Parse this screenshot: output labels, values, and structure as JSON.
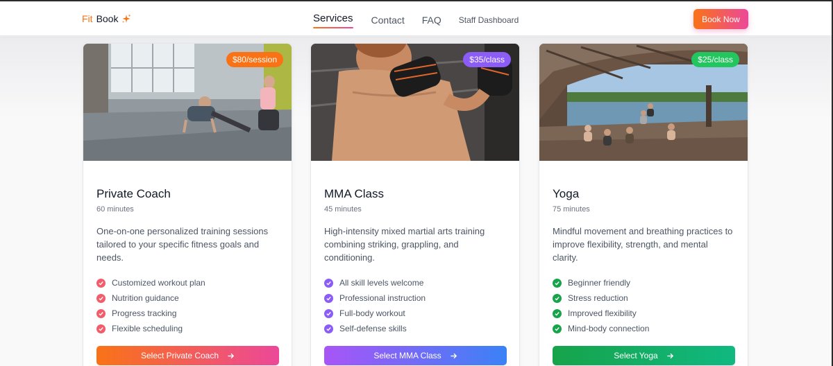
{
  "header": {
    "logo": {
      "part1": "Fit",
      "part2": "Book",
      "icon": "sparkle-icon"
    },
    "nav": {
      "services": "Services",
      "contact": "Contact",
      "faq": "FAQ",
      "staff": "Staff Dashboard"
    },
    "cta": "Book Now"
  },
  "colors": {
    "brand_orange": "#f97316",
    "brand_pink": "#ec4899",
    "purple": "#8b5cf6",
    "blue": "#3b82f6",
    "green": "#16a34a"
  },
  "services": [
    {
      "title": "Private Coach",
      "price": "$80/session",
      "duration": "60 minutes",
      "description": "One-on-one personalized training sessions tailored to your specific fitness goals and needs.",
      "features": [
        "Customized workout plan",
        "Nutrition guidance",
        "Progress tracking",
        "Flexible scheduling"
      ],
      "button": "Select Private Coach",
      "image": "gym-training-photo"
    },
    {
      "title": "MMA Class",
      "price": "$35/class",
      "duration": "45 minutes",
      "description": "High-intensity mixed martial arts training combining striking, grappling, and conditioning.",
      "features": [
        "All skill levels welcome",
        "Professional instruction",
        "Full-body workout",
        "Self-defense skills"
      ],
      "button": "Select MMA Class",
      "image": "mma-fighter-photo"
    },
    {
      "title": "Yoga",
      "price": "$25/class",
      "duration": "75 minutes",
      "description": "Mindful movement and breathing practices to improve flexibility, strength, and mental clarity.",
      "features": [
        "Beginner friendly",
        "Stress reduction",
        "Improved flexibility",
        "Mind-body connection"
      ],
      "button": "Select Yoga",
      "image": "yoga-lakeside-photo"
    }
  ]
}
